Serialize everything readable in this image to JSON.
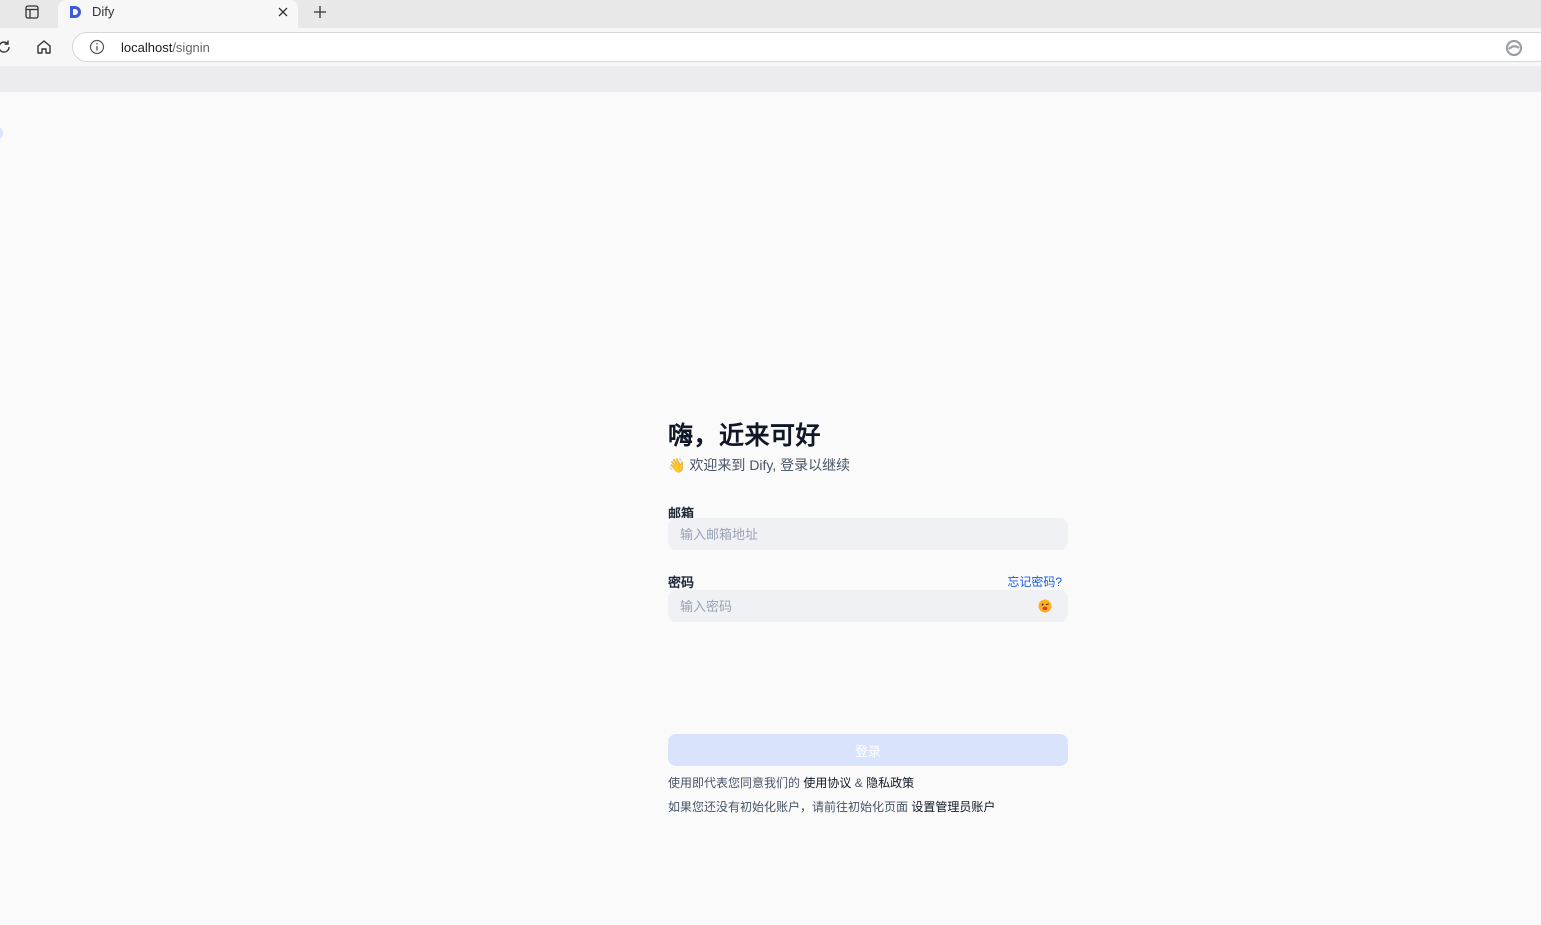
{
  "browser": {
    "tab_title": "Dify",
    "url_host": "localhost",
    "url_path": "/signin"
  },
  "signin": {
    "title": "嗨，近来可好",
    "subtitle_emoji": "👋",
    "subtitle": "欢迎来到 Dify, 登录以继续",
    "email_label": "邮箱",
    "email_placeholder": "输入邮箱地址",
    "password_label": "密码",
    "forgot_password": "忘记密码?",
    "password_placeholder": "输入密码",
    "submit_label": "登录",
    "terms_prefix": "使用即代表您同意我们的",
    "terms_link": "使用协议",
    "terms_and": "&",
    "privacy_link": "隐私政策",
    "setup_prefix": "如果您还没有初始化账户，请前往初始化页面",
    "setup_link": "设置管理员账户"
  },
  "colors": {
    "accent": "#155eef",
    "button_disabled": "#d9e4fc",
    "input_bg": "#f0f1f4",
    "page_bg": "#fafafa"
  },
  "icons": {
    "tab_actions": "tab-actions-icon",
    "favicon": "dify-logo-icon",
    "close": "close-icon",
    "new_tab": "plus-icon",
    "refresh": "refresh-icon",
    "home": "home-icon",
    "site_info": "info-icon",
    "edge": "edge-icon",
    "password_toggle": "eye-icon"
  }
}
